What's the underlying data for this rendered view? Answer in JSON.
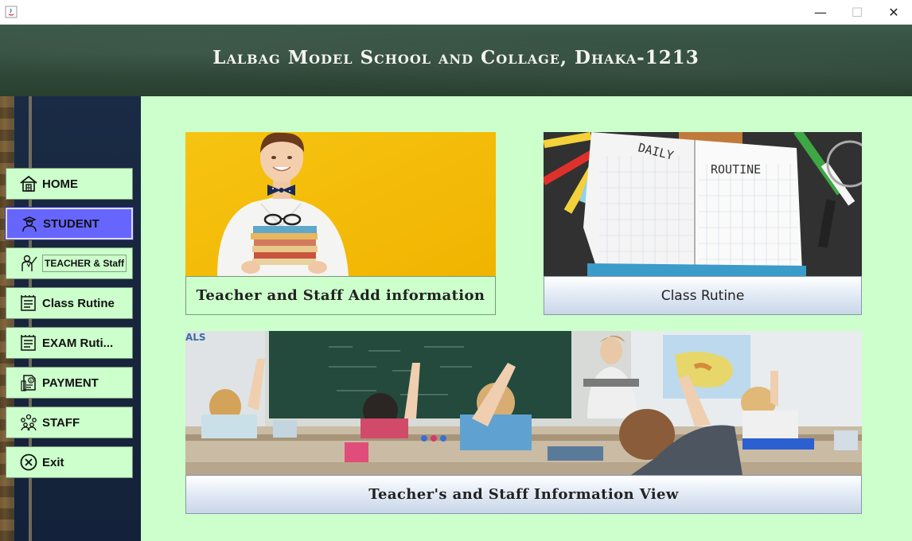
{
  "window": {
    "minimize_glyph": "—",
    "maximize_glyph": "☐",
    "close_glyph": "✕"
  },
  "header": {
    "title": "Lalbag Model School and Collage, Dhaka-1213"
  },
  "sidebar": {
    "items": [
      {
        "label": "HOME",
        "icon": "home-icon"
      },
      {
        "label": "STUDENT",
        "icon": "student-icon",
        "active": true
      },
      {
        "label": "TEACHER & Staff",
        "icon": "teacher-icon"
      },
      {
        "label": "Class Rutine",
        "icon": "routine-icon"
      },
      {
        "label": "EXAM Ruti...",
        "icon": "exam-icon"
      },
      {
        "label": "PAYMENT",
        "icon": "payment-icon"
      },
      {
        "label": "STAFF",
        "icon": "staff-icon"
      },
      {
        "label": "Exit",
        "icon": "exit-icon"
      }
    ]
  },
  "main": {
    "cards": [
      {
        "caption": "Teacher and Staff Add information",
        "image": "boy-with-books-photo"
      },
      {
        "caption": "Class Rutine",
        "image": "daily-routine-notebook-photo",
        "notebook_text_1": "DAILY",
        "notebook_text_2": "ROUTINE"
      },
      {
        "caption": "Teacher's and Staff Information View",
        "image": "classroom-students-photo"
      }
    ]
  },
  "colors": {
    "main_bg": "#ccffcc",
    "active_nav": "#6666ff",
    "header_bg": "#2f4a3b"
  }
}
